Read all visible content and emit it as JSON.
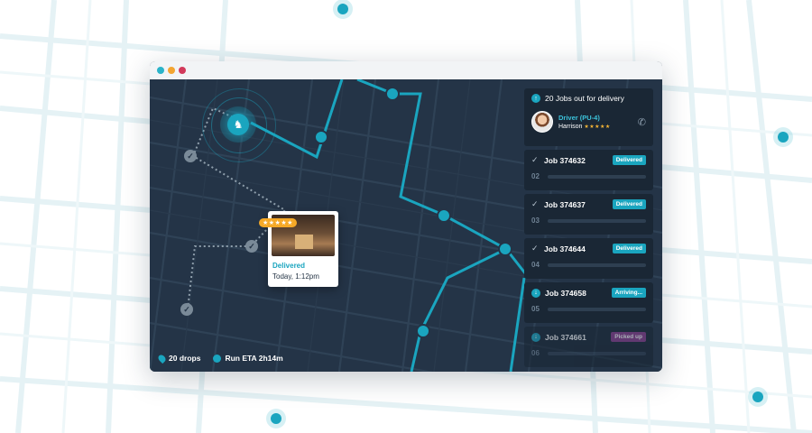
{
  "colors": {
    "accent": "#1aa5bf",
    "map_bg": "#243447",
    "card_bg": "#1a2735",
    "delivered": "#1aa5bf",
    "arriving": "#1aa5bf",
    "picked_up": "#8b3d8e",
    "star": "#f6b535"
  },
  "window": {
    "traffic_lights": [
      "#2ab3c9",
      "#f3a531",
      "#d23a5b"
    ]
  },
  "panel": {
    "header": {
      "icon": "arrow-up-icon",
      "text": "20 Jobs out for delivery"
    },
    "driver": {
      "label": "Driver (PU-4)",
      "name": "Harrison",
      "stars": "★★★★★",
      "rating": 5,
      "icon": "phone-icon"
    }
  },
  "jobs": [
    {
      "title": "Job 374632",
      "status": "Delivered",
      "number": "02",
      "icon": "check-icon"
    },
    {
      "title": "Job 374637",
      "status": "Delivered",
      "number": "03",
      "icon": "check-icon"
    },
    {
      "title": "Job 374644",
      "status": "Delivered",
      "number": "04",
      "icon": "check-icon"
    },
    {
      "title": "Job 374658",
      "status": "Arriving...",
      "number": "05",
      "icon": "arrow-down-icon"
    },
    {
      "title": "Job 374661",
      "status": "Picked up",
      "number": "06",
      "icon": "arrow-down-icon"
    }
  ],
  "stats": {
    "drops": "20 drops",
    "eta": "Run ETA 2h14m"
  },
  "popup": {
    "rating_stars": "★★★★★",
    "status": "Delivered",
    "time": "Today, 1:12pm"
  },
  "hub": {
    "icon": "llama-icon",
    "glyph": "♞"
  }
}
